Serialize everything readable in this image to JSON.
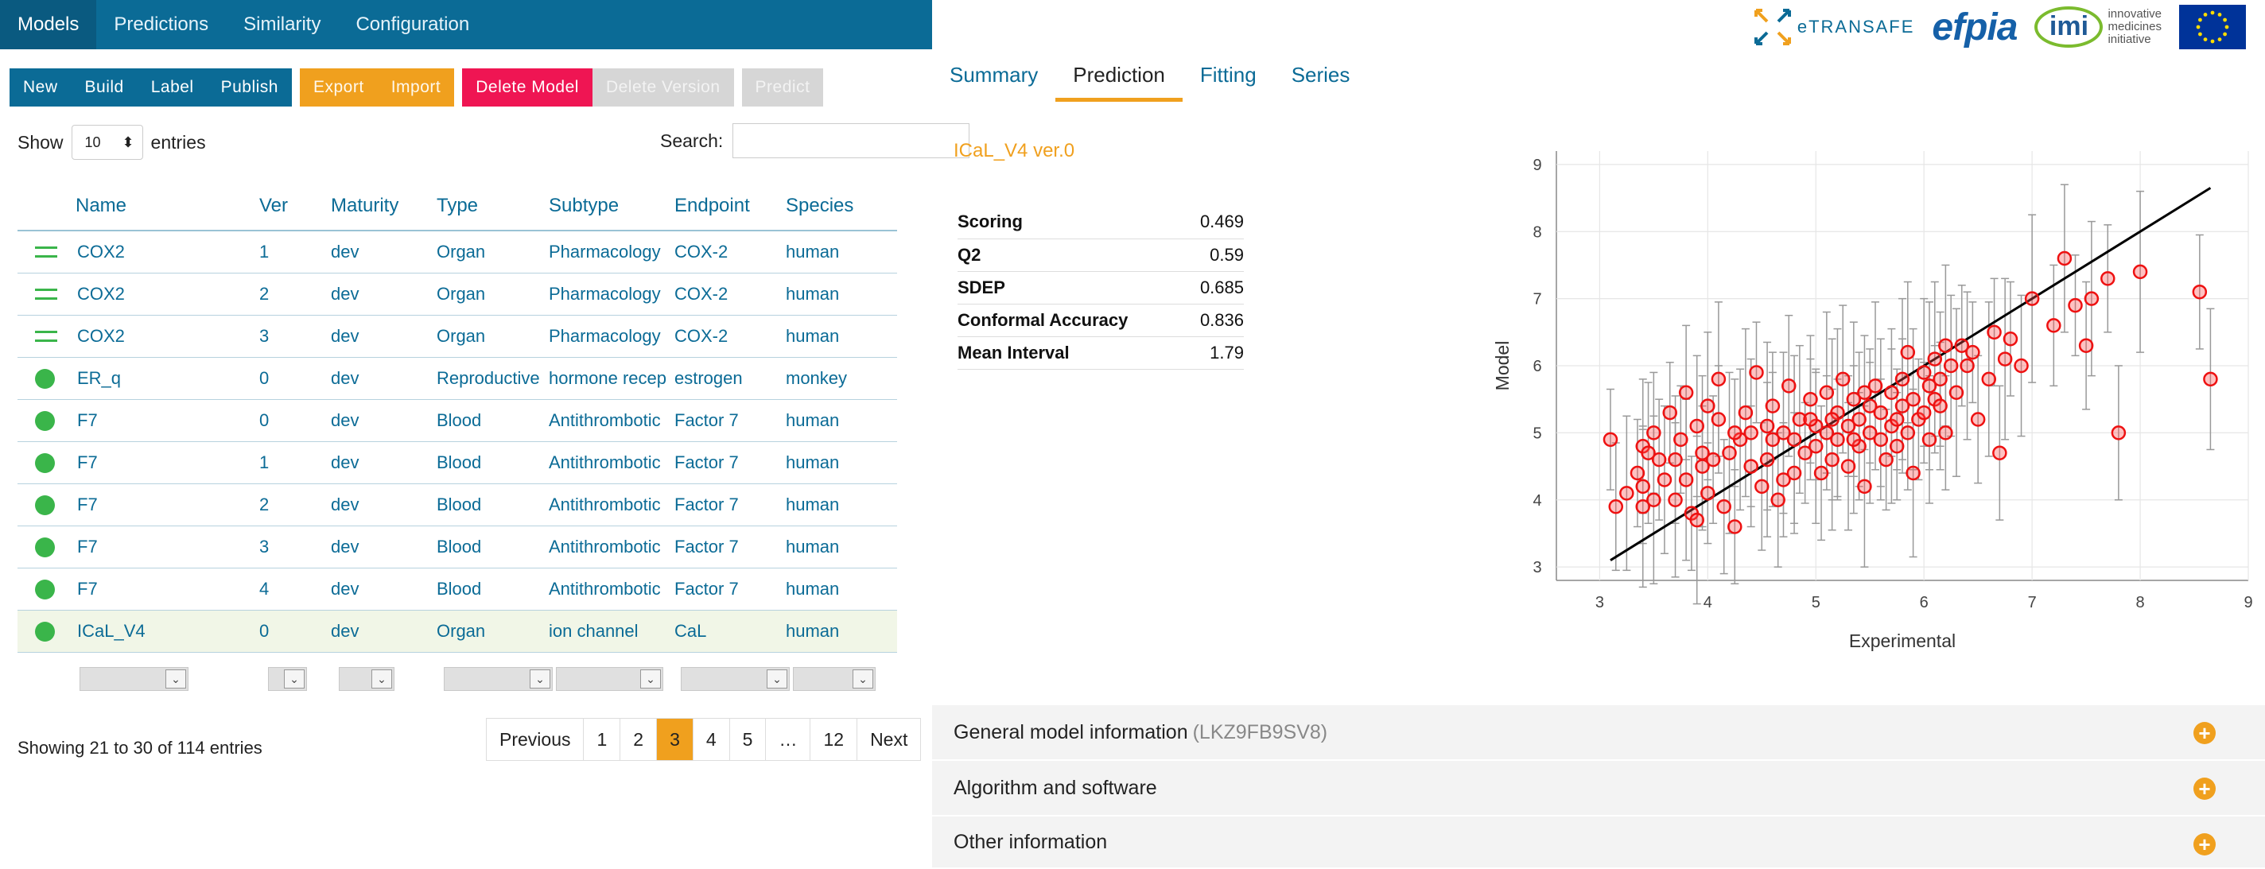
{
  "nav": {
    "tabs": [
      "Models",
      "Predictions",
      "Similarity",
      "Configuration"
    ]
  },
  "toolbar": {
    "blue": [
      "New",
      "Build",
      "Label",
      "Publish"
    ],
    "orange": [
      "Export",
      "Import"
    ],
    "delete_model": "Delete Model",
    "delete_version": "Delete Version",
    "predict": "Predict"
  },
  "table_controls": {
    "show": "Show",
    "length": "10",
    "entries": "entries",
    "search": "Search:"
  },
  "table": {
    "headers": [
      "Name",
      "Ver",
      "Maturity",
      "Type",
      "Subtype",
      "Endpoint",
      "Species"
    ],
    "rows": [
      {
        "icon": "lines",
        "name": "COX2",
        "ver": "1",
        "maturity": "dev",
        "type": "Organ",
        "subtype": "Pharmacology",
        "endpoint": "COX-2",
        "species": "human"
      },
      {
        "icon": "lines",
        "name": "COX2",
        "ver": "2",
        "maturity": "dev",
        "type": "Organ",
        "subtype": "Pharmacology",
        "endpoint": "COX-2",
        "species": "human"
      },
      {
        "icon": "lines",
        "name": "COX2",
        "ver": "3",
        "maturity": "dev",
        "type": "Organ",
        "subtype": "Pharmacology",
        "endpoint": "COX-2",
        "species": "human"
      },
      {
        "icon": "dot",
        "name": "ER_q",
        "ver": "0",
        "maturity": "dev",
        "type": "Reproductive",
        "subtype": "hormone recep",
        "endpoint": "estrogen",
        "species": "monkey"
      },
      {
        "icon": "dot",
        "name": "F7",
        "ver": "0",
        "maturity": "dev",
        "type": "Blood",
        "subtype": "Antithrombotic",
        "endpoint": "Factor 7",
        "species": "human"
      },
      {
        "icon": "dot",
        "name": "F7",
        "ver": "1",
        "maturity": "dev",
        "type": "Blood",
        "subtype": "Antithrombotic",
        "endpoint": "Factor 7",
        "species": "human"
      },
      {
        "icon": "dot",
        "name": "F7",
        "ver": "2",
        "maturity": "dev",
        "type": "Blood",
        "subtype": "Antithrombotic",
        "endpoint": "Factor 7",
        "species": "human"
      },
      {
        "icon": "dot",
        "name": "F7",
        "ver": "3",
        "maturity": "dev",
        "type": "Blood",
        "subtype": "Antithrombotic",
        "endpoint": "Factor 7",
        "species": "human"
      },
      {
        "icon": "dot",
        "name": "F7",
        "ver": "4",
        "maturity": "dev",
        "type": "Blood",
        "subtype": "Antithrombotic",
        "endpoint": "Factor 7",
        "species": "human"
      },
      {
        "icon": "dot",
        "name": "ICaL_V4",
        "ver": "0",
        "maturity": "dev",
        "type": "Organ",
        "subtype": "ion channel",
        "endpoint": "CaL",
        "species": "human",
        "selected": true
      }
    ]
  },
  "info": "Showing 21 to 30 of 114 entries",
  "pager": [
    "Previous",
    "1",
    "2",
    "3",
    "4",
    "5",
    "…",
    "12",
    "Next"
  ],
  "pager_current": "3",
  "logos": {
    "etransafe": "eTRANSAFE",
    "efpia": "efpia",
    "imi": "imi",
    "imi_text": [
      "innovative",
      "medicines",
      "initiative"
    ]
  },
  "right_tabs": [
    "Summary",
    "Prediction",
    "Fitting",
    "Series"
  ],
  "model_title": "ICaL_V4 ver.0",
  "metrics": [
    {
      "k": "Scoring",
      "v": "0.469"
    },
    {
      "k": "Q2",
      "v": "0.59"
    },
    {
      "k": "SDEP",
      "v": "0.685"
    },
    {
      "k": "Conformal Accuracy",
      "v": "0.836"
    },
    {
      "k": "Mean Interval",
      "v": "1.79"
    }
  ],
  "accordion": [
    {
      "label": "General model information",
      "sub": "(LKZ9FB9SV8)"
    },
    {
      "label": "Algorithm and software",
      "sub": ""
    },
    {
      "label": "Other information",
      "sub": ""
    }
  ],
  "colors": {
    "primary": "#0b6b96",
    "accent": "#f0a01e",
    "danger": "#ef1553",
    "points": "#ee1111"
  },
  "chart_data": {
    "type": "scatter",
    "xlabel": "Experimental",
    "ylabel": "Model",
    "xlim": [
      2.6,
      9.0
    ],
    "ylim": [
      2.8,
      9.2
    ],
    "xticks": [
      3,
      4,
      5,
      6,
      7,
      8,
      9
    ],
    "yticks": [
      3,
      4,
      5,
      6,
      7,
      8,
      9
    ],
    "grid": true,
    "fit_line": [
      [
        3.1,
        3.1
      ],
      [
        8.65,
        8.65
      ]
    ],
    "points": [
      [
        3.1,
        4.9
      ],
      [
        3.15,
        3.9
      ],
      [
        3.25,
        4.1
      ],
      [
        3.35,
        4.4
      ],
      [
        3.4,
        4.8
      ],
      [
        3.4,
        3.9
      ],
      [
        3.4,
        4.2
      ],
      [
        3.45,
        4.7
      ],
      [
        3.5,
        4.0
      ],
      [
        3.5,
        5.0
      ],
      [
        3.6,
        4.3
      ],
      [
        3.65,
        5.3
      ],
      [
        3.7,
        4.6
      ],
      [
        3.7,
        4.0
      ],
      [
        3.75,
        4.9
      ],
      [
        3.8,
        5.6
      ],
      [
        3.8,
        4.3
      ],
      [
        3.85,
        3.8
      ],
      [
        3.9,
        5.1
      ],
      [
        3.9,
        3.7
      ],
      [
        3.95,
        4.5
      ],
      [
        4.0,
        5.4
      ],
      [
        4.0,
        4.1
      ],
      [
        4.05,
        4.6
      ],
      [
        4.1,
        5.8
      ],
      [
        4.1,
        5.2
      ],
      [
        4.15,
        3.9
      ],
      [
        4.2,
        4.7
      ],
      [
        4.25,
        3.6
      ],
      [
        4.3,
        4.9
      ],
      [
        4.35,
        5.3
      ],
      [
        4.4,
        4.5
      ],
      [
        4.4,
        5.0
      ],
      [
        4.45,
        5.9
      ],
      [
        4.5,
        4.2
      ],
      [
        4.55,
        4.6
      ],
      [
        4.6,
        5.4
      ],
      [
        4.65,
        4.0
      ],
      [
        4.7,
        5.0
      ],
      [
        4.7,
        4.3
      ],
      [
        4.75,
        5.7
      ],
      [
        4.8,
        4.9
      ],
      [
        4.8,
        4.4
      ],
      [
        4.85,
        5.2
      ],
      [
        4.9,
        4.7
      ],
      [
        4.95,
        5.5
      ],
      [
        5.0,
        4.8
      ],
      [
        5.0,
        5.1
      ],
      [
        5.05,
        4.4
      ],
      [
        5.1,
        5.6
      ],
      [
        5.1,
        5.0
      ],
      [
        5.15,
        4.6
      ],
      [
        5.2,
        5.3
      ],
      [
        5.2,
        4.9
      ],
      [
        5.25,
        5.8
      ],
      [
        5.3,
        5.1
      ],
      [
        5.3,
        4.5
      ],
      [
        5.35,
        5.5
      ],
      [
        5.4,
        4.8
      ],
      [
        5.4,
        5.2
      ],
      [
        5.45,
        4.2
      ],
      [
        5.5,
        5.4
      ],
      [
        5.5,
        5.0
      ],
      [
        5.55,
        5.7
      ],
      [
        5.6,
        4.9
      ],
      [
        5.6,
        5.3
      ],
      [
        5.65,
        4.6
      ],
      [
        5.7,
        5.6
      ],
      [
        5.7,
        5.1
      ],
      [
        5.75,
        4.8
      ],
      [
        5.8,
        5.4
      ],
      [
        5.8,
        5.8
      ],
      [
        5.85,
        5.0
      ],
      [
        5.9,
        5.5
      ],
      [
        5.9,
        4.4
      ],
      [
        5.95,
        5.2
      ],
      [
        6.0,
        5.9
      ],
      [
        6.0,
        5.3
      ],
      [
        6.05,
        4.9
      ],
      [
        6.1,
        6.1
      ],
      [
        6.1,
        5.5
      ],
      [
        6.15,
        5.8
      ],
      [
        6.2,
        6.3
      ],
      [
        6.2,
        5.0
      ],
      [
        6.25,
        6.0
      ],
      [
        6.3,
        5.6
      ],
      [
        6.35,
        6.3
      ],
      [
        6.4,
        6.0
      ],
      [
        6.45,
        6.2
      ],
      [
        6.5,
        5.2
      ],
      [
        6.6,
        5.8
      ],
      [
        6.65,
        6.5
      ],
      [
        6.7,
        4.7
      ],
      [
        6.75,
        6.1
      ],
      [
        6.8,
        6.4
      ],
      [
        6.9,
        6.0
      ],
      [
        7.0,
        7.0
      ],
      [
        7.2,
        6.6
      ],
      [
        7.3,
        7.6
      ],
      [
        7.4,
        6.9
      ],
      [
        7.5,
        6.3
      ],
      [
        7.55,
        7.0
      ],
      [
        7.7,
        7.3
      ],
      [
        7.8,
        5.0
      ],
      [
        8.0,
        7.4
      ],
      [
        8.55,
        7.1
      ],
      [
        8.65,
        5.8
      ],
      [
        4.55,
        5.1
      ],
      [
        4.95,
        5.2
      ],
      [
        5.35,
        4.9
      ],
      [
        5.75,
        5.2
      ],
      [
        6.15,
        5.4
      ],
      [
        3.95,
        4.7
      ],
      [
        4.25,
        5.0
      ],
      [
        4.6,
        4.9
      ],
      [
        5.15,
        5.2
      ],
      [
        5.45,
        5.6
      ],
      [
        5.85,
        6.2
      ],
      [
        6.05,
        5.7
      ],
      [
        3.55,
        4.6
      ]
    ]
  }
}
